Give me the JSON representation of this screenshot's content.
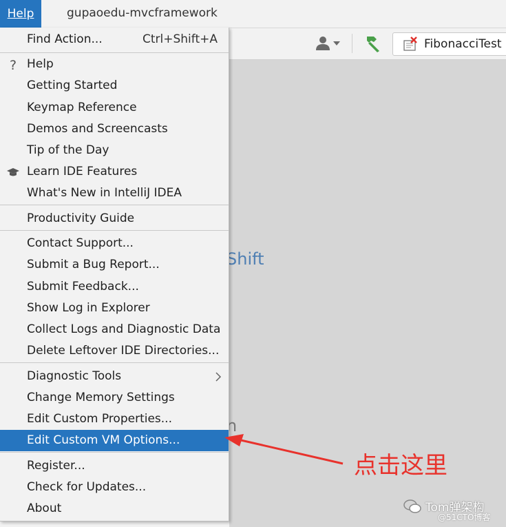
{
  "menubar": {
    "help_menu": "Help",
    "project_title": "gupaoedu-mvcframework"
  },
  "toolbar": {
    "user_icon": "user-dropdown-icon",
    "build_icon": "hammer-icon",
    "run_config": "FibonacciTest",
    "run_config_icon": "test-config-error-icon"
  },
  "editor": {
    "hint_shift": "Shift",
    "hint_n": "n"
  },
  "menu": {
    "find_action": {
      "label": "Find Action...",
      "shortcut": "Ctrl+Shift+A"
    },
    "help": "Help",
    "help_icon": "question-mark-icon",
    "getting_started": "Getting Started",
    "keymap_reference": "Keymap Reference",
    "demos": "Demos and Screencasts",
    "tip_of_the_day": "Tip of the Day",
    "learn_ide": "Learn IDE Features",
    "learn_ide_icon": "graduation-cap-icon",
    "whats_new": "What's New in IntelliJ IDEA",
    "productivity_guide": "Productivity Guide",
    "contact_support": "Contact Support...",
    "submit_bug": "Submit a Bug Report...",
    "submit_feedback": "Submit Feedback...",
    "show_log": "Show Log in Explorer",
    "collect_logs": "Collect Logs and Diagnostic Data",
    "delete_leftover": "Delete Leftover IDE Directories...",
    "diagnostic_tools": "Diagnostic Tools",
    "change_memory": "Change Memory Settings",
    "edit_custom_properties": "Edit Custom Properties...",
    "edit_custom_vm": "Edit Custom VM Options...",
    "register": "Register...",
    "check_updates": "Check for Updates...",
    "about": "About"
  },
  "annotation": {
    "text": "点击这里",
    "color": "#e8322c"
  },
  "watermark": {
    "name": "Tom弹架构",
    "site": "@51CTO博客"
  },
  "colors": {
    "accent": "#2675bf",
    "background": "#f2f2f2"
  }
}
